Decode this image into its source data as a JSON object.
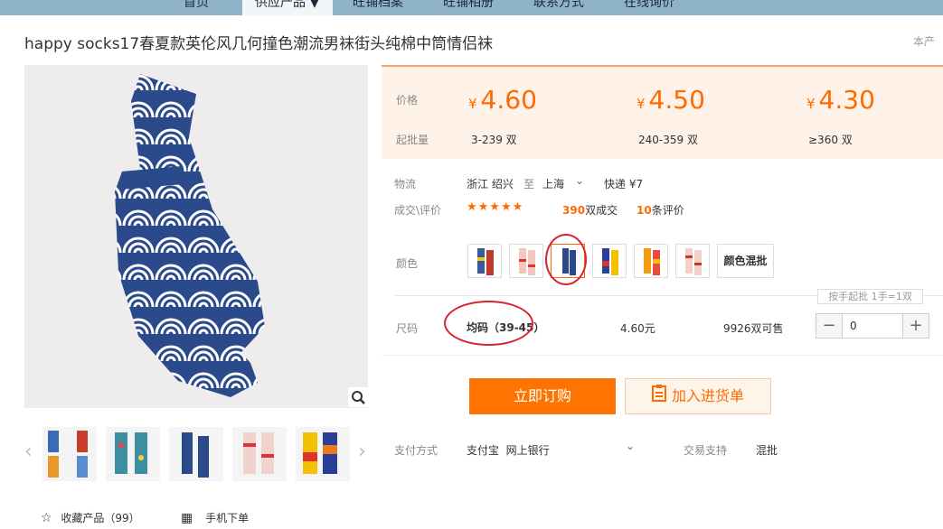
{
  "nav": {
    "items": [
      "首页",
      "供应产品 ▼",
      "旺铺档案",
      "旺铺相册",
      "联系方式",
      "在线询价"
    ],
    "active_index": 1
  },
  "product": {
    "title": "happy socks17春夏款英伦风几何撞色潮流男袜街头纯棉中筒情侣袜",
    "corner_text": "本产"
  },
  "price": {
    "price_label": "价格",
    "moq_label": "起批量",
    "currency": "¥",
    "tiers": [
      {
        "price": "4.60",
        "range": "3-239 双"
      },
      {
        "price": "4.50",
        "range": "240-359 双"
      },
      {
        "price": "4.30",
        "range": "≥360 双"
      }
    ]
  },
  "logistics": {
    "label": "物流",
    "from": "浙江 绍兴",
    "to_word": "至",
    "to": "上海",
    "chevron": "chevron-down-icon",
    "express": "快递 ¥7"
  },
  "deals": {
    "label": "成交\\评价",
    "stars": "★★★★★",
    "rating": 5,
    "deal_count": "390",
    "deal_suffix": "双成交",
    "review_count": "10",
    "review_suffix": "条评价"
  },
  "color": {
    "label": "颜色",
    "mixed_label": "颜色混批",
    "selected_index": 2
  },
  "size": {
    "tip": "按手起批 1手=1双",
    "label": "尺码",
    "value": "均码（39-45）",
    "unit_price": "4.60元",
    "stock": "9926双可售",
    "quantity": "0",
    "minus": "−",
    "plus": "+"
  },
  "actions": {
    "buy_now": "立即订购",
    "add_to_cart": "加入进货单",
    "cart_icon": "clipboard-icon"
  },
  "payment": {
    "label": "支付方式",
    "value": "支付宝  网上银行",
    "trade_label": "交易支持",
    "trade_value": "混批"
  },
  "footer": {
    "favorite": "收藏产品（99）",
    "mobile_order": "手机下单"
  },
  "colors": {
    "accent": "#ff6a00",
    "sock_blue": "#2a4a8c",
    "price_bg": "#fff2e8",
    "highlight": "#d9232e"
  }
}
